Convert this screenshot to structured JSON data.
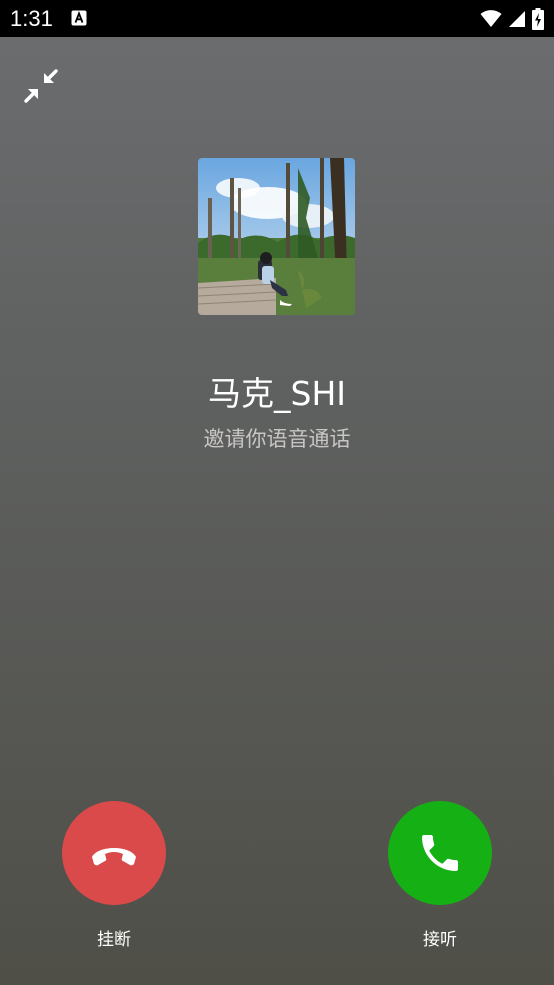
{
  "status_bar": {
    "time": "1:31",
    "icons": [
      "notification-a-icon",
      "wifi-icon",
      "signal-icon",
      "battery-charging-icon"
    ]
  },
  "call": {
    "minimize_icon": "minimize-arrows-icon",
    "caller_name": "马克_SHI",
    "subtitle": "邀请你语音通话"
  },
  "actions": {
    "decline": {
      "label": "挂断",
      "color": "#db4a4a",
      "icon": "hang-up-icon"
    },
    "accept": {
      "label": "接听",
      "color": "#14b014",
      "icon": "phone-icon"
    }
  }
}
